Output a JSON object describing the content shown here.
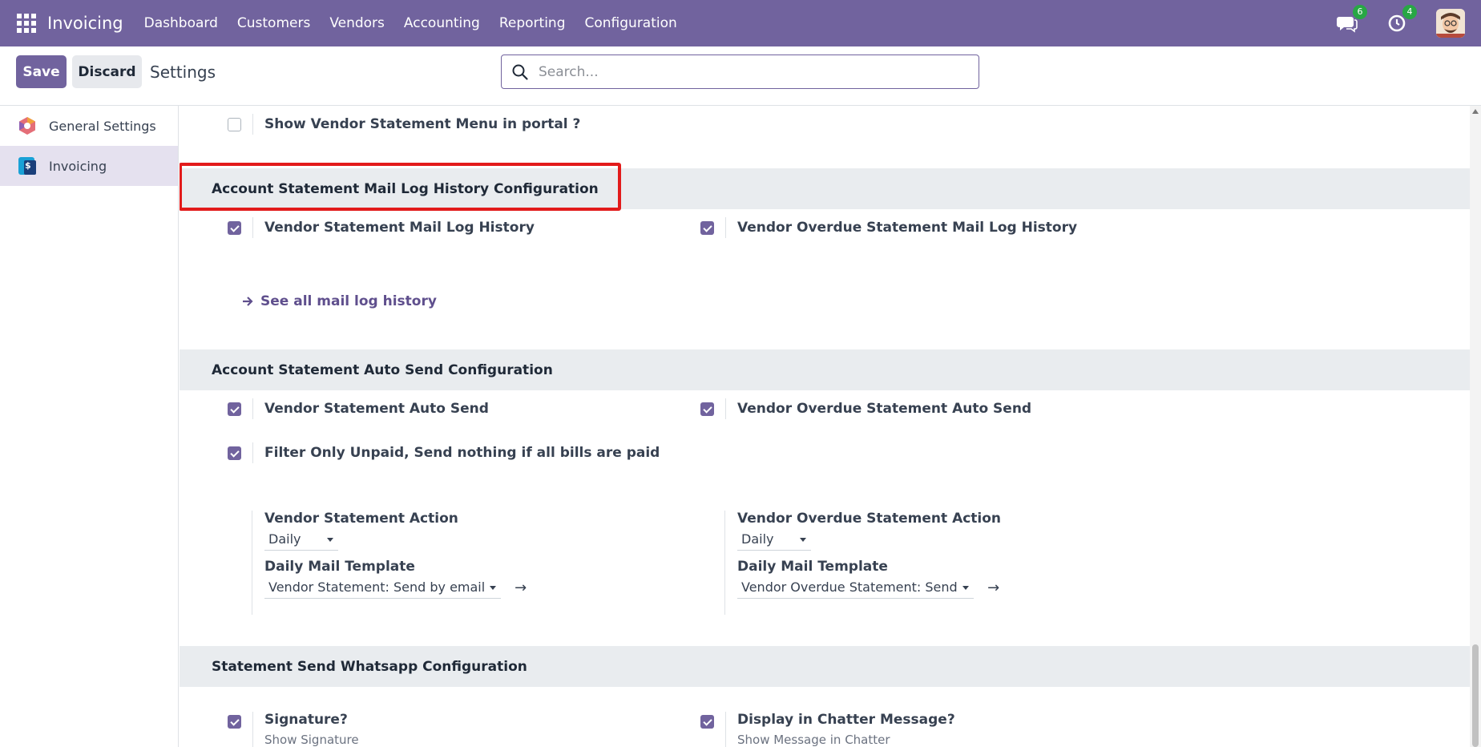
{
  "navbar": {
    "brand": "Invoicing",
    "menu": [
      "Dashboard",
      "Customers",
      "Vendors",
      "Accounting",
      "Reporting",
      "Configuration"
    ],
    "messages_count": "6",
    "activities_count": "4"
  },
  "control": {
    "save_label": "Save",
    "discard_label": "Discard",
    "title": "Settings",
    "search_placeholder": "Search..."
  },
  "sidebar": {
    "items": [
      {
        "label": "General Settings",
        "icon": "odoo-logo-icon",
        "active": false
      },
      {
        "label": "Invoicing",
        "icon": "invoicing-app-icon",
        "active": true
      }
    ]
  },
  "main": {
    "portal_setting": {
      "label": "Show Vendor Statement Menu in portal ?",
      "checked": false
    },
    "mail_log_section": {
      "title": "Account Statement Mail Log History Configuration",
      "left": {
        "label": "Vendor Statement Mail Log History",
        "checked": true
      },
      "right": {
        "label": "Vendor Overdue Statement Mail Log History",
        "checked": true
      },
      "link": "See all mail log history"
    },
    "auto_send_section": {
      "title": "Account Statement Auto Send Configuration",
      "left": {
        "label": "Vendor Statement Auto Send",
        "checked": true
      },
      "right": {
        "label": "Vendor Overdue Statement Auto Send",
        "checked": true
      },
      "filter": {
        "label": "Filter Only Unpaid, Send nothing if all bills are paid",
        "checked": true
      },
      "left_action": {
        "label": "Vendor Statement Action",
        "value": "Daily",
        "template_label": "Daily Mail Template",
        "template_value": "Vendor Statement: Send by email"
      },
      "right_action": {
        "label": "Vendor Overdue Statement Action",
        "value": "Daily",
        "template_label": "Daily Mail Template",
        "template_value": "Vendor Overdue Statement: Send"
      }
    },
    "whatsapp_section": {
      "title": "Statement Send Whatsapp Configuration",
      "left": {
        "label": "Signature?",
        "sub": "Show Signature",
        "checked": true
      },
      "right": {
        "label": "Display in Chatter Message?",
        "sub": "Show Message in Chatter",
        "checked": true
      }
    }
  },
  "colors": {
    "brand": "#71639e",
    "highlight": "#e21b1b",
    "badge": "#28a745"
  }
}
